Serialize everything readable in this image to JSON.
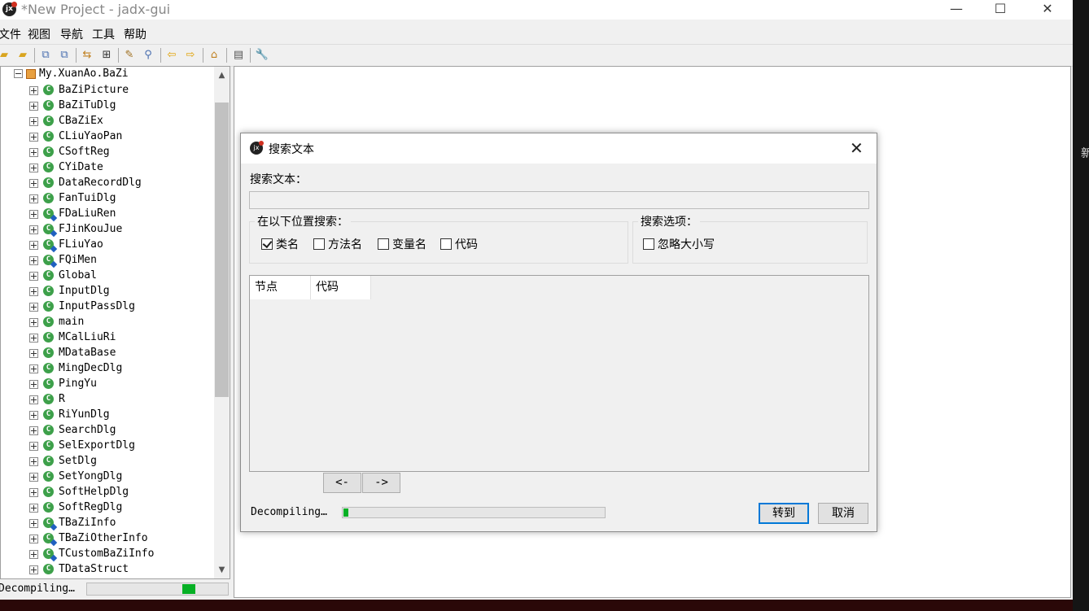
{
  "window": {
    "title": "*New Project - jadx-gui",
    "controls": {
      "minimize": "—",
      "maximize": "☐",
      "close": "✕"
    }
  },
  "menu": [
    "文件",
    "视图",
    "导航",
    "工具",
    "帮助"
  ],
  "toolbar": {
    "icons": [
      "open-file-icon",
      "add-files-icon",
      "sync-icon",
      "save-icon",
      "flatten-packages-icon",
      "expand-icon",
      "decompile-icon",
      "search-icon",
      "back-icon",
      "forward-icon",
      "deobfuscation-icon",
      "log-icon",
      "preferences-icon"
    ]
  },
  "tree": {
    "root": "My.XuanAo.BaZi",
    "items": [
      {
        "label": "BaZiPicture",
        "special": false
      },
      {
        "label": "BaZiTuDlg",
        "special": false
      },
      {
        "label": "CBaZiEx",
        "special": false
      },
      {
        "label": "CLiuYaoPan",
        "special": false
      },
      {
        "label": "CSoftReg",
        "special": false
      },
      {
        "label": "CYiDate",
        "special": false
      },
      {
        "label": "DataRecordDlg",
        "special": false
      },
      {
        "label": "FanTuiDlg",
        "special": false
      },
      {
        "label": "FDaLiuRen",
        "special": true
      },
      {
        "label": "FJinKouJue",
        "special": true
      },
      {
        "label": "FLiuYao",
        "special": true
      },
      {
        "label": "FQiMen",
        "special": true
      },
      {
        "label": "Global",
        "special": false
      },
      {
        "label": "InputDlg",
        "special": false
      },
      {
        "label": "InputPassDlg",
        "special": false
      },
      {
        "label": "main",
        "special": false
      },
      {
        "label": "MCalLiuRi",
        "special": false
      },
      {
        "label": "MDataBase",
        "special": false
      },
      {
        "label": "MingDecDlg",
        "special": false
      },
      {
        "label": "PingYu",
        "special": false
      },
      {
        "label": "R",
        "special": false
      },
      {
        "label": "RiYunDlg",
        "special": false
      },
      {
        "label": "SearchDlg",
        "special": false
      },
      {
        "label": "SelExportDlg",
        "special": false
      },
      {
        "label": "SetDlg",
        "special": false
      },
      {
        "label": "SetYongDlg",
        "special": false
      },
      {
        "label": "SoftHelpDlg",
        "special": false
      },
      {
        "label": "SoftRegDlg",
        "special": false
      },
      {
        "label": "TBaZiInfo",
        "special": true
      },
      {
        "label": "TBaZiOtherInfo",
        "special": true
      },
      {
        "label": "TCustomBaZiInfo",
        "special": true
      },
      {
        "label": "TDataStruct",
        "special": false
      }
    ]
  },
  "statusbar": {
    "text": "Decompiling…",
    "progress": 0.1
  },
  "dialog": {
    "title": "搜索文本",
    "search_label": "搜索文本：",
    "search_value": "",
    "search_in_title": "在以下位置搜索：",
    "search_in": [
      {
        "label": "类名",
        "checked": true
      },
      {
        "label": "方法名",
        "checked": false
      },
      {
        "label": "变量名",
        "checked": false
      },
      {
        "label": "代码",
        "checked": false
      }
    ],
    "options_title": "搜索选项：",
    "ignore_case": {
      "label": "忽略大小写",
      "checked": false
    },
    "columns": [
      "节点",
      "代码"
    ],
    "prev_label": "<-",
    "next_label": "->",
    "status_text": "Decompiling…",
    "progress": 0.02,
    "goto_label": "转到",
    "cancel_label": "取消"
  },
  "desktop_text": "新"
}
